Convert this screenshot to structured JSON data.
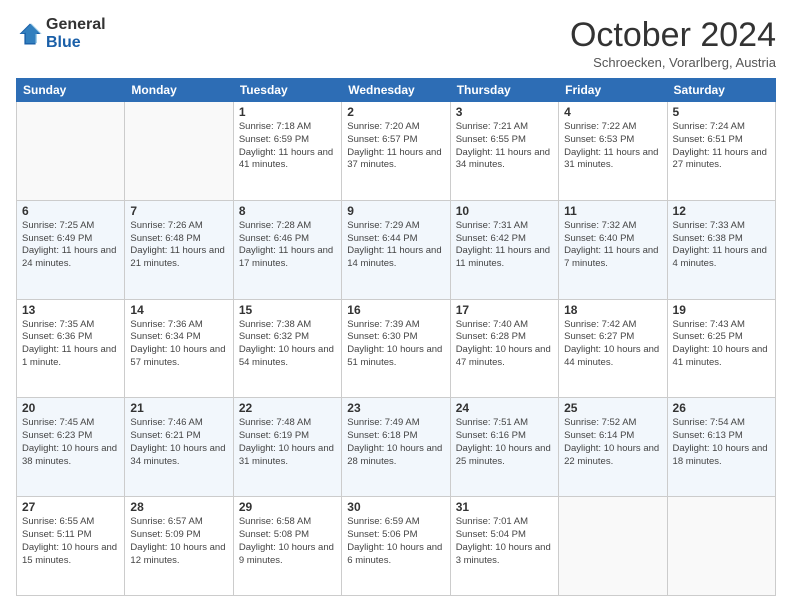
{
  "logo": {
    "general": "General",
    "blue": "Blue"
  },
  "header": {
    "title": "October 2024",
    "subtitle": "Schroecken, Vorarlberg, Austria"
  },
  "weekdays": [
    "Sunday",
    "Monday",
    "Tuesday",
    "Wednesday",
    "Thursday",
    "Friday",
    "Saturday"
  ],
  "weeks": [
    [
      {
        "day": "",
        "sunrise": "",
        "sunset": "",
        "daylight": ""
      },
      {
        "day": "",
        "sunrise": "",
        "sunset": "",
        "daylight": ""
      },
      {
        "day": "1",
        "sunrise": "Sunrise: 7:18 AM",
        "sunset": "Sunset: 6:59 PM",
        "daylight": "Daylight: 11 hours and 41 minutes."
      },
      {
        "day": "2",
        "sunrise": "Sunrise: 7:20 AM",
        "sunset": "Sunset: 6:57 PM",
        "daylight": "Daylight: 11 hours and 37 minutes."
      },
      {
        "day": "3",
        "sunrise": "Sunrise: 7:21 AM",
        "sunset": "Sunset: 6:55 PM",
        "daylight": "Daylight: 11 hours and 34 minutes."
      },
      {
        "day": "4",
        "sunrise": "Sunrise: 7:22 AM",
        "sunset": "Sunset: 6:53 PM",
        "daylight": "Daylight: 11 hours and 31 minutes."
      },
      {
        "day": "5",
        "sunrise": "Sunrise: 7:24 AM",
        "sunset": "Sunset: 6:51 PM",
        "daylight": "Daylight: 11 hours and 27 minutes."
      }
    ],
    [
      {
        "day": "6",
        "sunrise": "Sunrise: 7:25 AM",
        "sunset": "Sunset: 6:49 PM",
        "daylight": "Daylight: 11 hours and 24 minutes."
      },
      {
        "day": "7",
        "sunrise": "Sunrise: 7:26 AM",
        "sunset": "Sunset: 6:48 PM",
        "daylight": "Daylight: 11 hours and 21 minutes."
      },
      {
        "day": "8",
        "sunrise": "Sunrise: 7:28 AM",
        "sunset": "Sunset: 6:46 PM",
        "daylight": "Daylight: 11 hours and 17 minutes."
      },
      {
        "day": "9",
        "sunrise": "Sunrise: 7:29 AM",
        "sunset": "Sunset: 6:44 PM",
        "daylight": "Daylight: 11 hours and 14 minutes."
      },
      {
        "day": "10",
        "sunrise": "Sunrise: 7:31 AM",
        "sunset": "Sunset: 6:42 PM",
        "daylight": "Daylight: 11 hours and 11 minutes."
      },
      {
        "day": "11",
        "sunrise": "Sunrise: 7:32 AM",
        "sunset": "Sunset: 6:40 PM",
        "daylight": "Daylight: 11 hours and 7 minutes."
      },
      {
        "day": "12",
        "sunrise": "Sunrise: 7:33 AM",
        "sunset": "Sunset: 6:38 PM",
        "daylight": "Daylight: 11 hours and 4 minutes."
      }
    ],
    [
      {
        "day": "13",
        "sunrise": "Sunrise: 7:35 AM",
        "sunset": "Sunset: 6:36 PM",
        "daylight": "Daylight: 11 hours and 1 minute."
      },
      {
        "day": "14",
        "sunrise": "Sunrise: 7:36 AM",
        "sunset": "Sunset: 6:34 PM",
        "daylight": "Daylight: 10 hours and 57 minutes."
      },
      {
        "day": "15",
        "sunrise": "Sunrise: 7:38 AM",
        "sunset": "Sunset: 6:32 PM",
        "daylight": "Daylight: 10 hours and 54 minutes."
      },
      {
        "day": "16",
        "sunrise": "Sunrise: 7:39 AM",
        "sunset": "Sunset: 6:30 PM",
        "daylight": "Daylight: 10 hours and 51 minutes."
      },
      {
        "day": "17",
        "sunrise": "Sunrise: 7:40 AM",
        "sunset": "Sunset: 6:28 PM",
        "daylight": "Daylight: 10 hours and 47 minutes."
      },
      {
        "day": "18",
        "sunrise": "Sunrise: 7:42 AM",
        "sunset": "Sunset: 6:27 PM",
        "daylight": "Daylight: 10 hours and 44 minutes."
      },
      {
        "day": "19",
        "sunrise": "Sunrise: 7:43 AM",
        "sunset": "Sunset: 6:25 PM",
        "daylight": "Daylight: 10 hours and 41 minutes."
      }
    ],
    [
      {
        "day": "20",
        "sunrise": "Sunrise: 7:45 AM",
        "sunset": "Sunset: 6:23 PM",
        "daylight": "Daylight: 10 hours and 38 minutes."
      },
      {
        "day": "21",
        "sunrise": "Sunrise: 7:46 AM",
        "sunset": "Sunset: 6:21 PM",
        "daylight": "Daylight: 10 hours and 34 minutes."
      },
      {
        "day": "22",
        "sunrise": "Sunrise: 7:48 AM",
        "sunset": "Sunset: 6:19 PM",
        "daylight": "Daylight: 10 hours and 31 minutes."
      },
      {
        "day": "23",
        "sunrise": "Sunrise: 7:49 AM",
        "sunset": "Sunset: 6:18 PM",
        "daylight": "Daylight: 10 hours and 28 minutes."
      },
      {
        "day": "24",
        "sunrise": "Sunrise: 7:51 AM",
        "sunset": "Sunset: 6:16 PM",
        "daylight": "Daylight: 10 hours and 25 minutes."
      },
      {
        "day": "25",
        "sunrise": "Sunrise: 7:52 AM",
        "sunset": "Sunset: 6:14 PM",
        "daylight": "Daylight: 10 hours and 22 minutes."
      },
      {
        "day": "26",
        "sunrise": "Sunrise: 7:54 AM",
        "sunset": "Sunset: 6:13 PM",
        "daylight": "Daylight: 10 hours and 18 minutes."
      }
    ],
    [
      {
        "day": "27",
        "sunrise": "Sunrise: 6:55 AM",
        "sunset": "Sunset: 5:11 PM",
        "daylight": "Daylight: 10 hours and 15 minutes."
      },
      {
        "day": "28",
        "sunrise": "Sunrise: 6:57 AM",
        "sunset": "Sunset: 5:09 PM",
        "daylight": "Daylight: 10 hours and 12 minutes."
      },
      {
        "day": "29",
        "sunrise": "Sunrise: 6:58 AM",
        "sunset": "Sunset: 5:08 PM",
        "daylight": "Daylight: 10 hours and 9 minutes."
      },
      {
        "day": "30",
        "sunrise": "Sunrise: 6:59 AM",
        "sunset": "Sunset: 5:06 PM",
        "daylight": "Daylight: 10 hours and 6 minutes."
      },
      {
        "day": "31",
        "sunrise": "Sunrise: 7:01 AM",
        "sunset": "Sunset: 5:04 PM",
        "daylight": "Daylight: 10 hours and 3 minutes."
      },
      {
        "day": "",
        "sunrise": "",
        "sunset": "",
        "daylight": ""
      },
      {
        "day": "",
        "sunrise": "",
        "sunset": "",
        "daylight": ""
      }
    ]
  ]
}
